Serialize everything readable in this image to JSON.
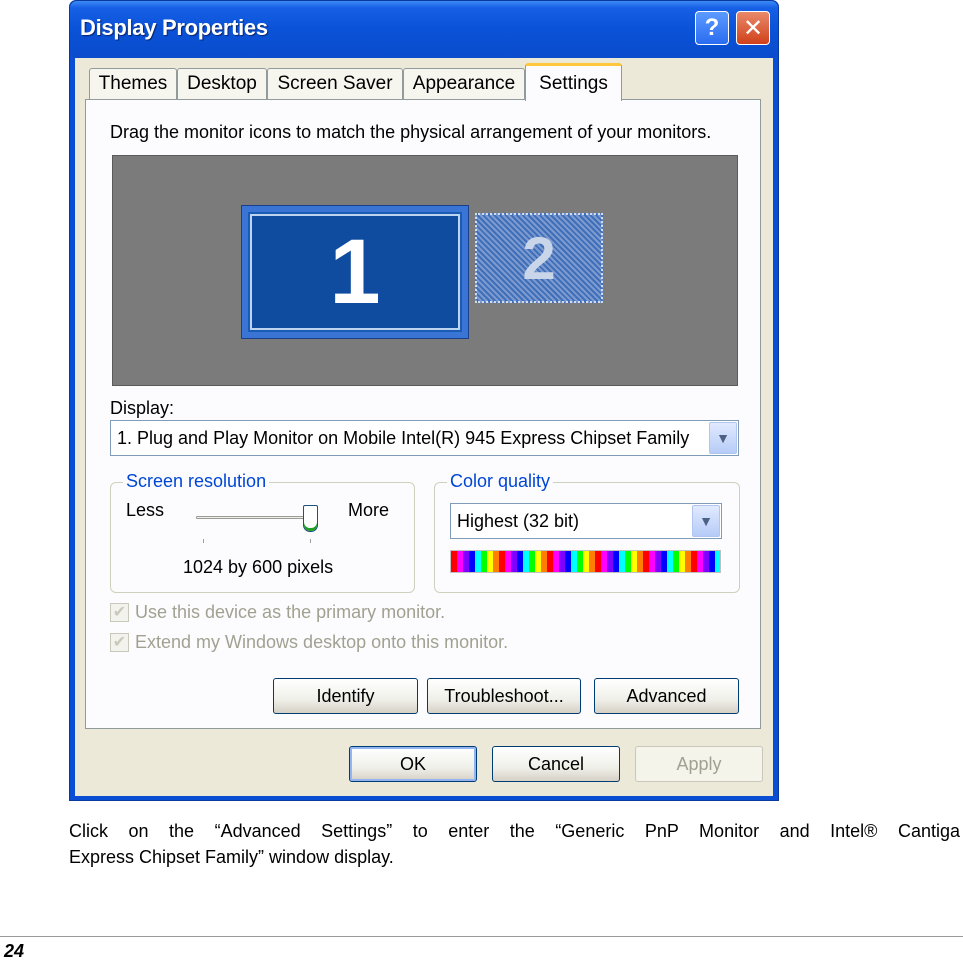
{
  "window": {
    "title": "Display Properties",
    "help_glyph": "?",
    "close_glyph": "✕"
  },
  "tabs": [
    {
      "label": "Themes"
    },
    {
      "label": "Desktop"
    },
    {
      "label": "Screen Saver"
    },
    {
      "label": "Appearance"
    },
    {
      "label": "Settings",
      "active": true
    }
  ],
  "settings": {
    "instruction": "Drag the monitor icons to match the physical arrangement of your monitors.",
    "monitors": [
      {
        "number": "1",
        "selected": true
      },
      {
        "number": "2",
        "selected": false
      }
    ],
    "display_label": "Display:",
    "display_value": "1. Plug and Play Monitor on Mobile Intel(R) 945 Express Chipset Family",
    "screen_resolution": {
      "legend": "Screen resolution",
      "less_label": "Less",
      "more_label": "More",
      "value_text": "1024 by 600 pixels",
      "slider_fraction": 1.0
    },
    "color_quality": {
      "legend": "Color quality",
      "value": "Highest (32 bit)"
    },
    "checkboxes": [
      {
        "label": "Use this device as the primary monitor.",
        "checked": true,
        "enabled": false
      },
      {
        "label": "Extend my Windows desktop onto this monitor.",
        "checked": true,
        "enabled": false
      }
    ],
    "buttons": {
      "identify": "Identify",
      "troubleshoot": "Troubleshoot...",
      "advanced": "Advanced"
    }
  },
  "dialog_buttons": {
    "ok": "OK",
    "cancel": "Cancel",
    "apply": "Apply"
  },
  "caption": {
    "line1": "Click on the “Advanced Settings” to enter the “Generic PnP Monitor and Intel® Cantiga",
    "line2": "Express Chipset Family” window display."
  },
  "page_number": "24",
  "colors": {
    "titlebar": "#0a52d8",
    "dialog_face": "#ece9d8",
    "group_legend": "#0046d5",
    "monitor_selected": "#1a5cb3",
    "active_tab_highlight": "#ffc83c"
  }
}
